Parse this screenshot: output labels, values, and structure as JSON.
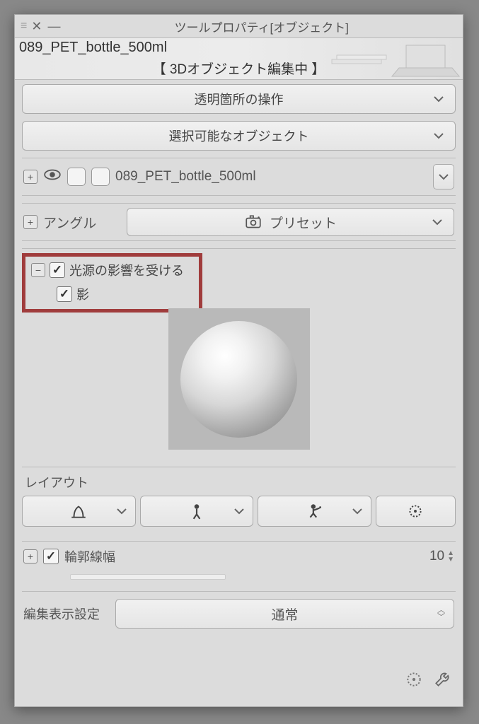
{
  "title": "ツールプロパティ[オブジェクト]",
  "object_name": "089_PET_bottle_500ml",
  "editing_banner": "【 3Dオブジェクト編集中 】",
  "buttons": {
    "transparent_ops": "透明箇所の操作",
    "selectable_objects": "選択可能なオブジェクト"
  },
  "object_row": {
    "label": "089_PET_bottle_500ml"
  },
  "angle": {
    "label": "アングル",
    "preset": "プリセット"
  },
  "lighting": {
    "affected_label": "光源の影響を受ける",
    "affected_checked": true,
    "shadow_label": "影",
    "shadow_checked": true
  },
  "layout": {
    "label": "レイアウト"
  },
  "outline": {
    "label": "輪郭線幅",
    "checked": true,
    "value": "10"
  },
  "display_setting": {
    "label": "編集表示設定",
    "value": "通常"
  }
}
